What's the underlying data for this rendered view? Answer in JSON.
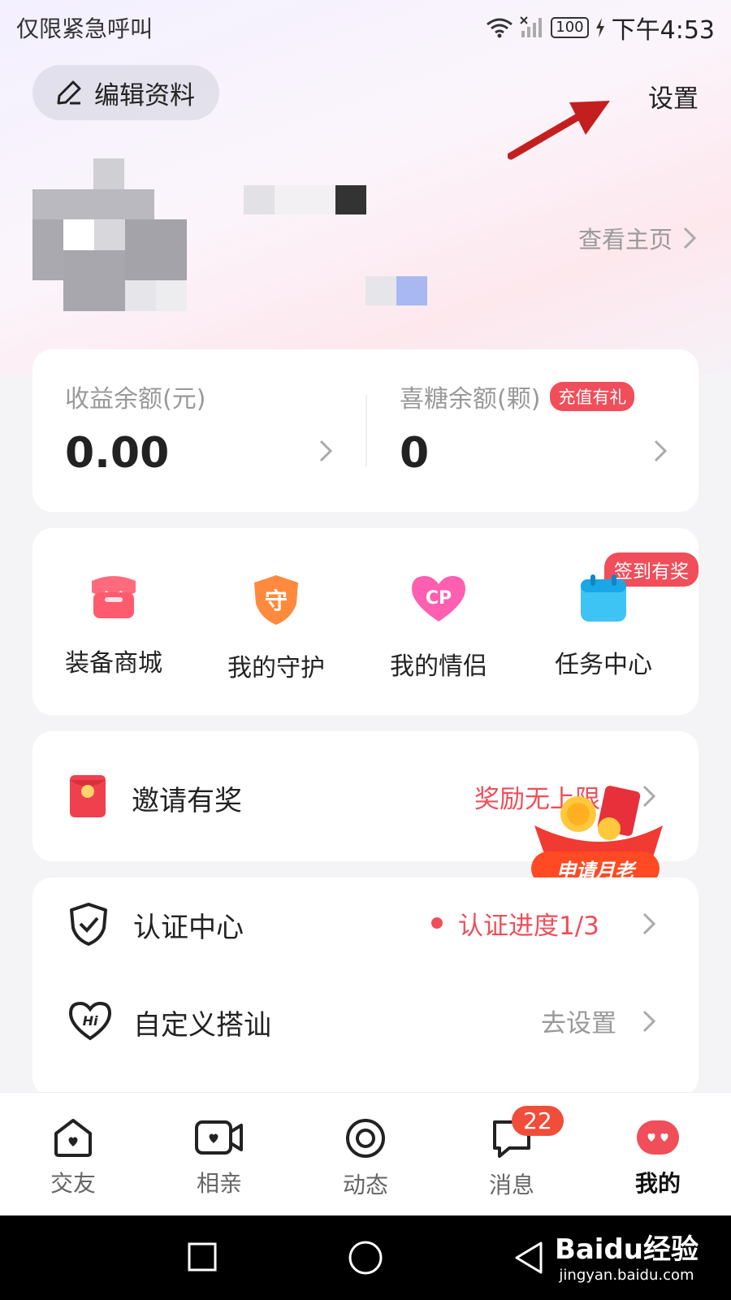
{
  "status_bar": {
    "left_text": "仅限紧急呼叫",
    "battery": "100",
    "time": "下午4:53"
  },
  "header": {
    "edit_profile": "编辑资料",
    "settings": "设置",
    "view_home": "查看主页"
  },
  "balance": {
    "income_label": "收益余额(元)",
    "income_value": "0.00",
    "candy_label": "喜糖余额(颗)",
    "candy_value": "0",
    "recharge_badge": "充值有礼"
  },
  "grid": {
    "checkin_badge": "签到有奖",
    "items": [
      {
        "label": "装备商城",
        "icon": "shop-icon"
      },
      {
        "label": "我的守护",
        "icon": "guard-shield-icon",
        "glyph": "守"
      },
      {
        "label": "我的情侣",
        "icon": "cp-heart-icon",
        "glyph": "CP"
      },
      {
        "label": "任务中心",
        "icon": "calendar-icon"
      }
    ]
  },
  "invite": {
    "label": "邀请有奖",
    "reward_text": "奖励无上限",
    "promo": "申请月老"
  },
  "list": [
    {
      "label": "认证中心",
      "right": "认证进度1/3",
      "icon": "shield-check-icon"
    },
    {
      "label": "自定义搭讪",
      "right": "去设置",
      "icon": "hi-heart-icon"
    }
  ],
  "tabs": [
    {
      "label": "交友",
      "icon": "home-icon"
    },
    {
      "label": "相亲",
      "icon": "video-icon"
    },
    {
      "label": "动态",
      "icon": "moments-icon"
    },
    {
      "label": "消息",
      "icon": "message-icon",
      "badge": "22"
    },
    {
      "label": "我的",
      "icon": "profile-icon"
    }
  ],
  "watermark": {
    "line1": "Baidu经验",
    "line2": "jingyan.baidu.com"
  },
  "colors": {
    "accent": "#f04e5a",
    "arrow": "#c41f1f"
  }
}
